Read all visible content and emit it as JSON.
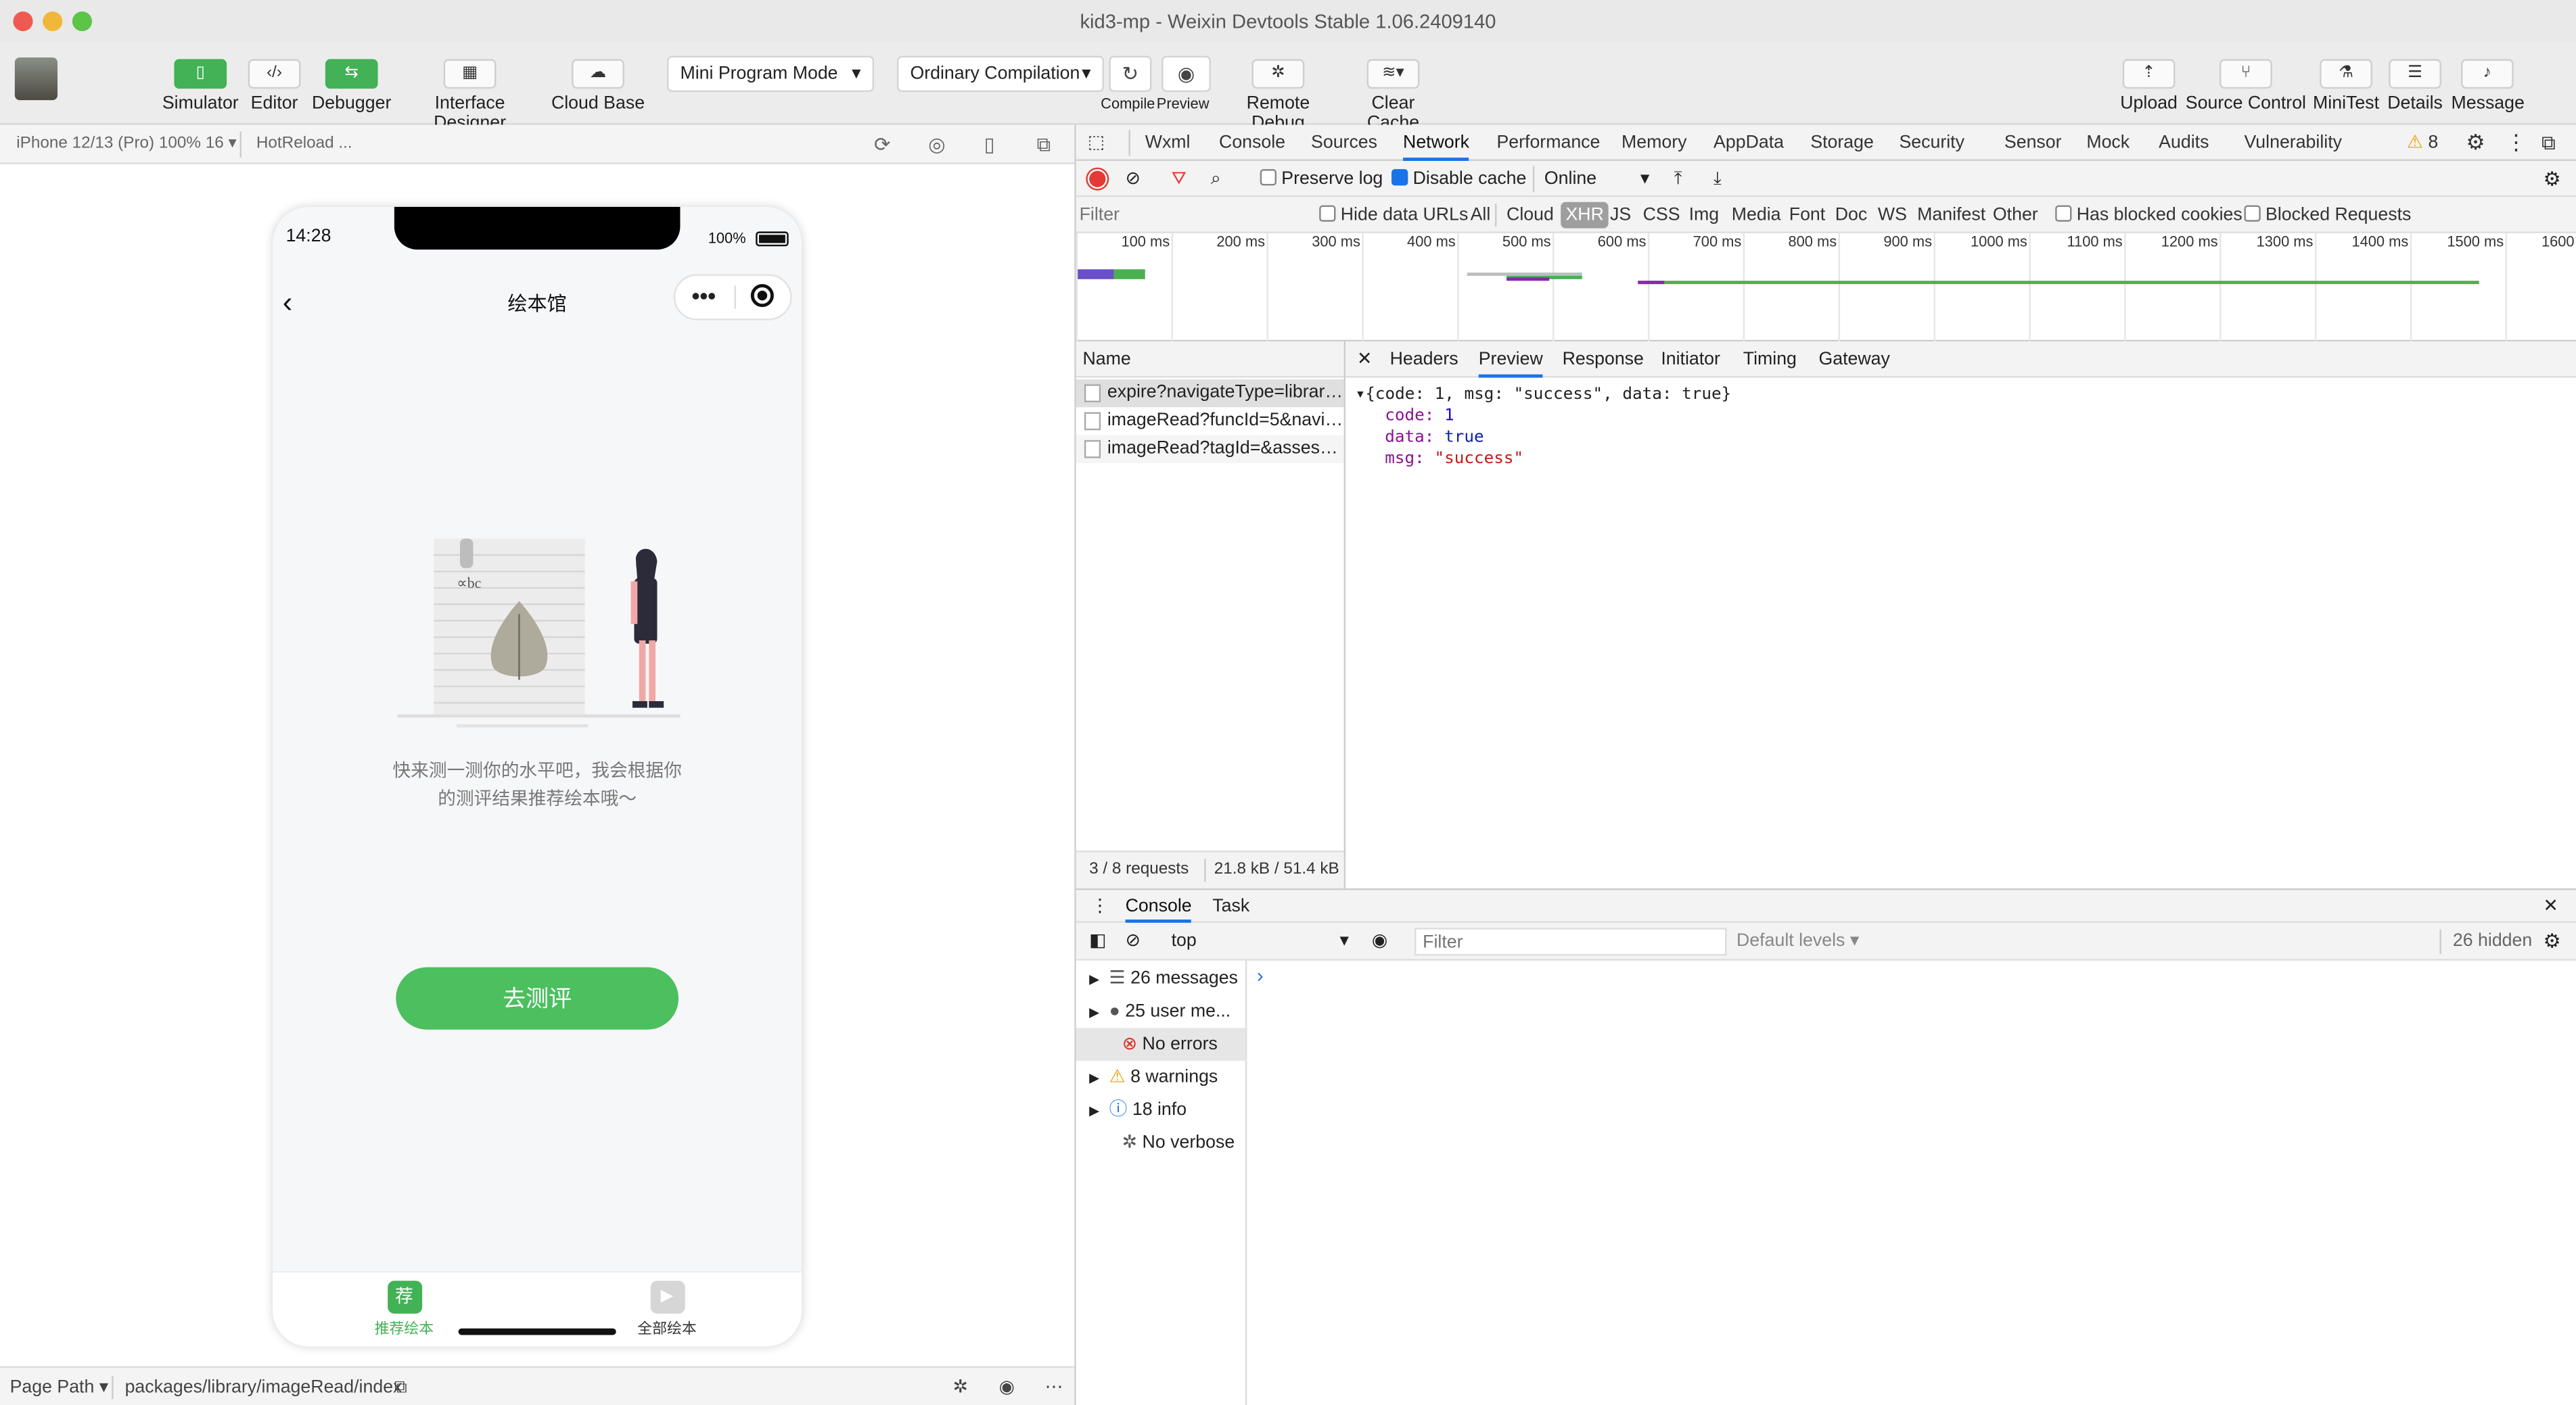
{
  "window": {
    "title": "kid3-mp - Weixin Devtools Stable 1.06.2409140"
  },
  "toolbar": {
    "simulator": "Simulator",
    "editor": "Editor",
    "debugger": "Debugger",
    "interface_designer": "Interface Designer",
    "cloud_base": "Cloud Base",
    "mode_select": "Mini Program Mode",
    "compile_select": "Ordinary Compilation",
    "compile": "Compile",
    "preview": "Preview",
    "remote_debug": "Remote Debug",
    "clear_cache": "Clear Cache",
    "upload": "Upload",
    "source_control": "Source Control",
    "minitest": "MiniTest",
    "details": "Details",
    "message": "Message"
  },
  "sim": {
    "device": "iPhone 12/13 (Pro) 100% 16 ▾",
    "hotreload": "HotReload ...",
    "status_time": "14:28",
    "battery": "100%",
    "page_title": "绘本馆",
    "empty_text_1": "快来测一测你的水平吧，我会根据你",
    "empty_text_2": "的测评结果推荐绘本哦～",
    "cta": "去测评",
    "tab1_icon": "荐",
    "tab1_label": "推荐绘本",
    "tab2_label": "全部绘本",
    "page_path_label": "Page Path",
    "page_path": "packages/library/imageRead/index"
  },
  "devtools": {
    "tabs": [
      "Wxml",
      "Console",
      "Sources",
      "Network",
      "Performance",
      "Memory",
      "AppData",
      "Storage",
      "Security",
      "Sensor",
      "Mock",
      "Audits",
      "Vulnerability"
    ],
    "active_tab": "Network",
    "warn_count": "8",
    "preserve_log": "Preserve log",
    "disable_cache": "Disable cache",
    "throttle": "Online",
    "filter_placeholder": "Filter",
    "hide_data_urls": "Hide data URLs",
    "types": [
      "All",
      "Cloud",
      "XHR",
      "JS",
      "CSS",
      "Img",
      "Media",
      "Font",
      "Doc",
      "WS",
      "Manifest",
      "Other"
    ],
    "active_type": "XHR",
    "blocked_cookies": "Has blocked cookies",
    "blocked_requests": "Blocked Requests",
    "ticks": [
      "100 ms",
      "200 ms",
      "300 ms",
      "400 ms",
      "500 ms",
      "600 ms",
      "700 ms",
      "800 ms",
      "900 ms",
      "1000 ms",
      "1100 ms",
      "1200 ms",
      "1300 ms",
      "1400 ms",
      "1500 ms",
      "1600"
    ],
    "name_header": "Name",
    "requests": [
      "expire?navigateType=library&...",
      "imageRead?funcId=5&naviga...",
      "imageRead?tagId=&assessS..."
    ],
    "summary_requests": "3 / 8 requests",
    "summary_size": "21.8 kB / 51.4 kB",
    "detail_tabs": [
      "Headers",
      "Preview",
      "Response",
      "Initiator",
      "Timing",
      "Gateway"
    ],
    "active_detail_tab": "Preview",
    "preview": {
      "summary": "{code: 1, msg: \"success\", data: true}",
      "code_key": "code:",
      "code_val": "1",
      "data_key": "data:",
      "data_val": "true",
      "msg_key": "msg:",
      "msg_val": "\"success\""
    }
  },
  "console": {
    "tabs": [
      "Console",
      "Task"
    ],
    "context": "top",
    "filter_placeholder": "Filter",
    "levels": "Default levels ▾",
    "hidden": "26 hidden",
    "side": [
      "26 messages",
      "25 user me...",
      "No errors",
      "8 warnings",
      "18 info",
      "No verbose"
    ],
    "prompt": "›"
  },
  "colors": {
    "accent_green": "#43b155",
    "cta_green": "#4cbf5f",
    "active_tab_blue": "#1a73e8"
  }
}
